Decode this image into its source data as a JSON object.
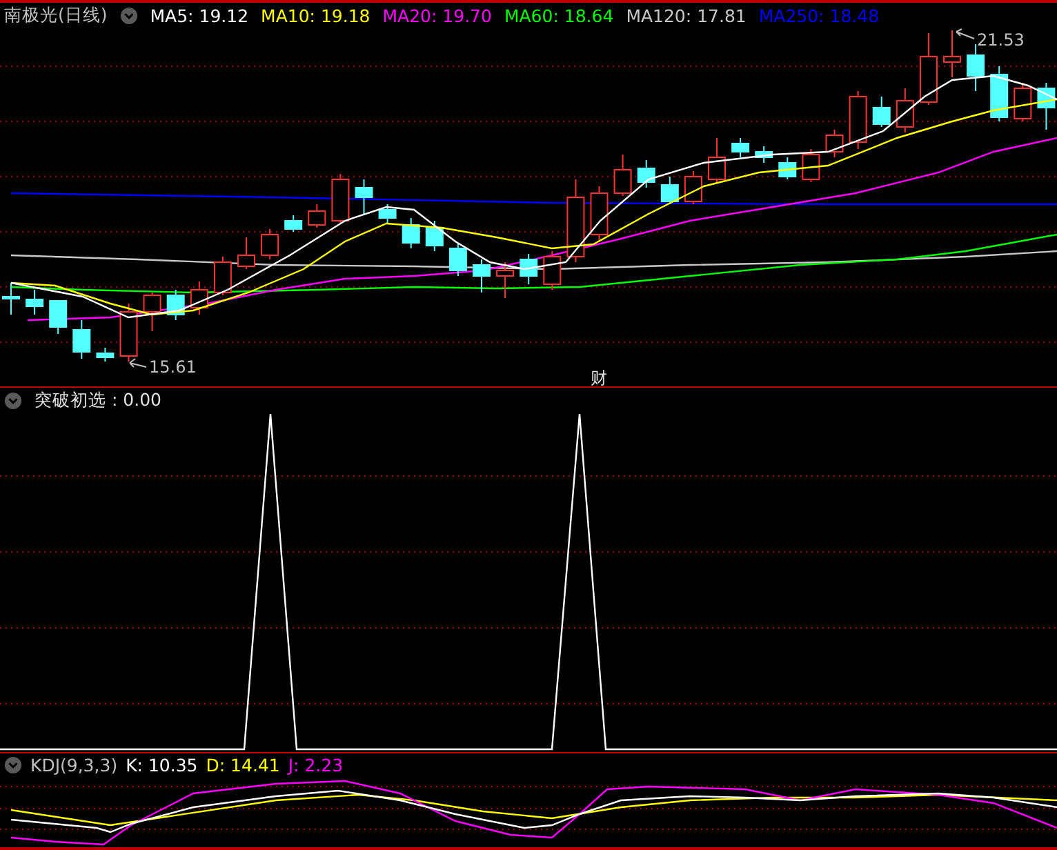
{
  "price_panel": {
    "title": "南极光(日线)",
    "indicators": [
      {
        "label": "MA5: 19.12",
        "color": "#ffffff"
      },
      {
        "label": "MA10: 19.18",
        "color": "#ffff00"
      },
      {
        "label": "MA20: 19.70",
        "color": "#ff00ff"
      },
      {
        "label": "MA60: 18.64",
        "color": "#00ff00"
      },
      {
        "label": "MA120: 17.81",
        "color": "#c8c8c8"
      },
      {
        "label": "MA250: 18.48",
        "color": "#0000ff"
      }
    ],
    "high_label": "21.53",
    "low_label": "15.61",
    "event_marker": "财"
  },
  "signal_panel": {
    "title": "突破初选 : 0.00"
  },
  "kdj_panel": {
    "title": "KDJ(9,3,3)",
    "indicators": [
      {
        "label": "K: 10.35",
        "color": "#ffffff"
      },
      {
        "label": "D: 14.41",
        "color": "#ffff00"
      },
      {
        "label": "J: 2.23",
        "color": "#ff00ff"
      }
    ]
  }
}
